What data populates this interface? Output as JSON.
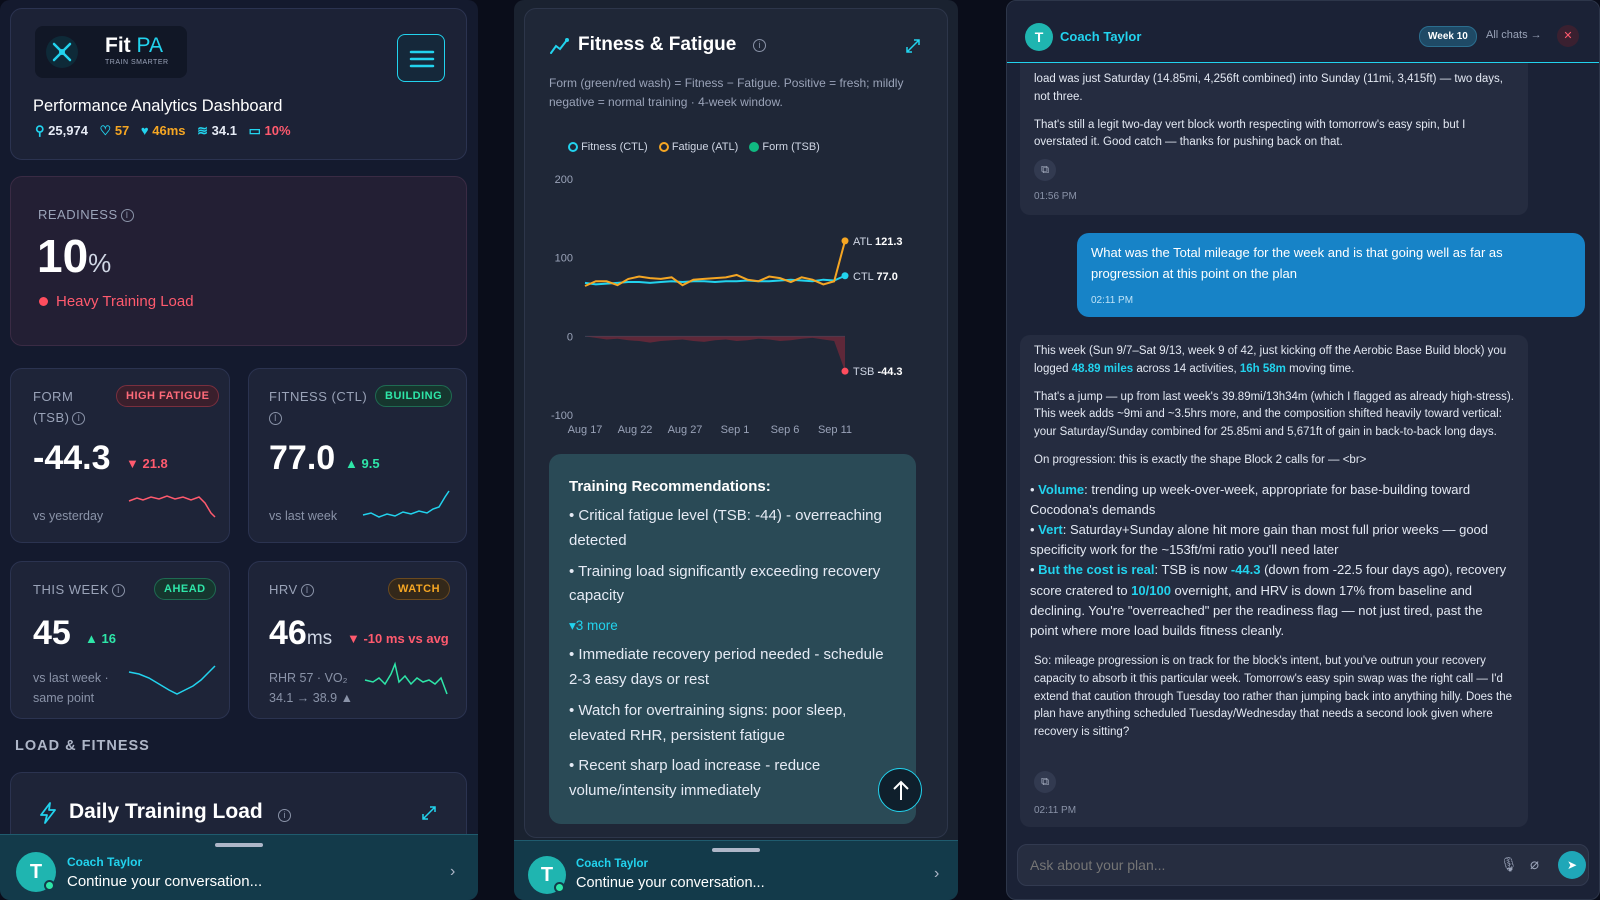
{
  "brand": {
    "name_a": "Fit",
    "name_b": "PA",
    "tagline": "TRAIN SMARTER"
  },
  "header": {
    "title": "Performance Analytics Dashboard",
    "stats": [
      "25,974",
      "57",
      "46ms",
      "34.1",
      "10%"
    ]
  },
  "readiness": {
    "label": "READINESS",
    "value": "10",
    "unit": "%",
    "status": "Heavy Training Load"
  },
  "form": {
    "label_a": "FORM",
    "label_b": "(TSB)",
    "badge": "HIGH FATIGUE",
    "value": "-44.3",
    "delta": "▼ 21.8",
    "sub": "vs yesterday"
  },
  "fitness": {
    "label": "FITNESS (CTL)",
    "badge": "BUILDING",
    "value": "77.0",
    "delta": "▲ 9.5",
    "sub": "vs last week"
  },
  "week": {
    "label": "THIS WEEK",
    "badge": "AHEAD",
    "value": "45",
    "delta": "▲ 16",
    "sub_a": "vs last week ·",
    "sub_b": "same point"
  },
  "hrv": {
    "label": "HRV",
    "badge": "WATCH",
    "value": "46",
    "unit": "ms",
    "delta": "▼ -10 ms vs avg",
    "sub_a": "RHR 57 · VO₂",
    "sub_b": "34.1 → 38.9 ▲"
  },
  "section": {
    "load_fitness": "LOAD & FITNESS",
    "daily_load": "Daily Training Load"
  },
  "coach": {
    "name": "Coach Taylor",
    "prompt": "Continue your conversation...",
    "initial": "T"
  },
  "ff": {
    "title": "Fitness & Fatigue",
    "desc": "Form (green/red wash) = Fitness − Fatigue. Positive = fresh; mildly negative = normal training · 4-week window."
  },
  "chart_data": {
    "type": "line",
    "title": "",
    "x": [
      "Aug 17",
      "Aug 22",
      "Aug 27",
      "Sep 1",
      "Sep 6",
      "Sep 11"
    ],
    "ylim": [
      -100,
      200
    ],
    "yticks": [
      200,
      100,
      0,
      -100
    ],
    "legend": [
      "Fitness (CTL)",
      "Fatigue (ATL)",
      "Form (TSB)"
    ],
    "series": [
      {
        "name": "Fitness (CTL)",
        "color": "#22d3ee",
        "values": [
          68,
          66,
          67,
          68,
          69,
          69,
          68,
          69,
          70,
          69,
          70,
          70,
          69,
          70,
          70,
          71,
          70,
          70,
          71,
          72,
          71,
          70,
          72,
          71,
          77
        ]
      },
      {
        "name": "Fatigue (ATL)",
        "color": "#f5a623",
        "values": [
          64,
          70,
          70,
          65,
          73,
          76,
          74,
          73,
          75,
          65,
          72,
          73,
          74,
          75,
          78,
          72,
          70,
          76,
          74,
          69,
          75,
          72,
          66,
          70,
          121.3
        ]
      },
      {
        "name": "Form (TSB)",
        "color": "#10b981",
        "values": [
          0,
          -2,
          -4,
          -3,
          -5,
          -6,
          -8,
          -6,
          -5,
          -4,
          -6,
          -7,
          -5,
          -4,
          -6,
          -5,
          -3,
          -4,
          -6,
          -5,
          -3,
          -2,
          -4,
          -6,
          -44.3
        ]
      }
    ],
    "end_labels": [
      {
        "tag": "ATL",
        "value": "121.3"
      },
      {
        "tag": "CTL",
        "value": "77.0"
      },
      {
        "tag": "TSB",
        "value": "-44.3"
      }
    ]
  },
  "recs": {
    "title": "Training Recommendations:",
    "items": [
      "• Critical fatigue level (TSB: -44) - overreaching detected",
      "• Training load significantly exceeding recovery capacity"
    ],
    "more": "▾3 more",
    "more_items": [
      "• Immediate recovery period needed - schedule 2-3 easy days or rest",
      "• Watch for overtraining signs: poor sleep, elevated RHR, persistent fatigue",
      "• Recent sharp load increase - reduce volume/intensity immediately"
    ]
  },
  "chat": {
    "title": "Coach Taylor",
    "week": "Week 10",
    "all": "All chats →",
    "m1": [
      "load was just Saturday (14.85mi, 4,256ft combined) into Sunday (11mi, 3,415ft) — two days, not three.",
      "That's still a legit two-day vert block worth respecting with tomorrow's easy spin, but I overstated it. Good catch — thanks for pushing back on that."
    ],
    "t1": "01:56 PM",
    "user": "What was the Total mileage for the week and is that going well as far as progression at this point on the plan",
    "t2": "02:11 PM",
    "a_p1_a": "This week (Sun 9/7–Sat 9/13, week 9 of 42, just kicking off the Aerobic Base Build block) you logged ",
    "a_miles": "48.89 miles",
    "a_p1_b": " across 14 activities, ",
    "a_time": "16h 58m",
    "a_p1_c": " moving time.",
    "a_p2": "That's a jump — up from last week's 39.89mi/13h34m (which I flagged as already high-stress). This week adds ~9mi and ~3.5hrs more, and the composition shifted heavily toward vertical: your Saturday/Sunday combined for 25.85mi and 5,671ft of gain in back-to-back long days.",
    "a_p3": "On progression: this is exactly the shape Block 2 calls for — <br>",
    "b1_k": "Volume",
    "b1": ": trending up week-over-week, appropriate for base-building toward Cocodona's demands",
    "b2_k": "Vert",
    "b2": ": Saturday+Sunday alone hit more gain than most full prior weeks — good specificity work for the ~153ft/mi ratio you'll need later",
    "b3_k": "But the cost is real",
    "b3_a": ": TSB is now ",
    "b3_v1": "-44.3",
    "b3_b": " (down from -22.5 four days ago), recovery score cratered to ",
    "b3_v2": "10/100",
    "b3_c": " overnight, and HRV is down 17% from baseline and declining. You're \"overreached\" per the readiness flag — not just tired, past the point where more load builds fitness cleanly.",
    "a_p4": "So: mileage progression is on track for the block's intent, but you've outrun your recovery capacity to absorb it this particular week. Tomorrow's easy spin swap was the right call — I'd extend that caution through Tuesday too rather than jumping back into anything hilly. Does the plan have anything scheduled Tuesday/Wednesday that needs a second look given where recovery is sitting?",
    "t3": "02:11 PM",
    "placeholder": "Ask about your plan..."
  }
}
